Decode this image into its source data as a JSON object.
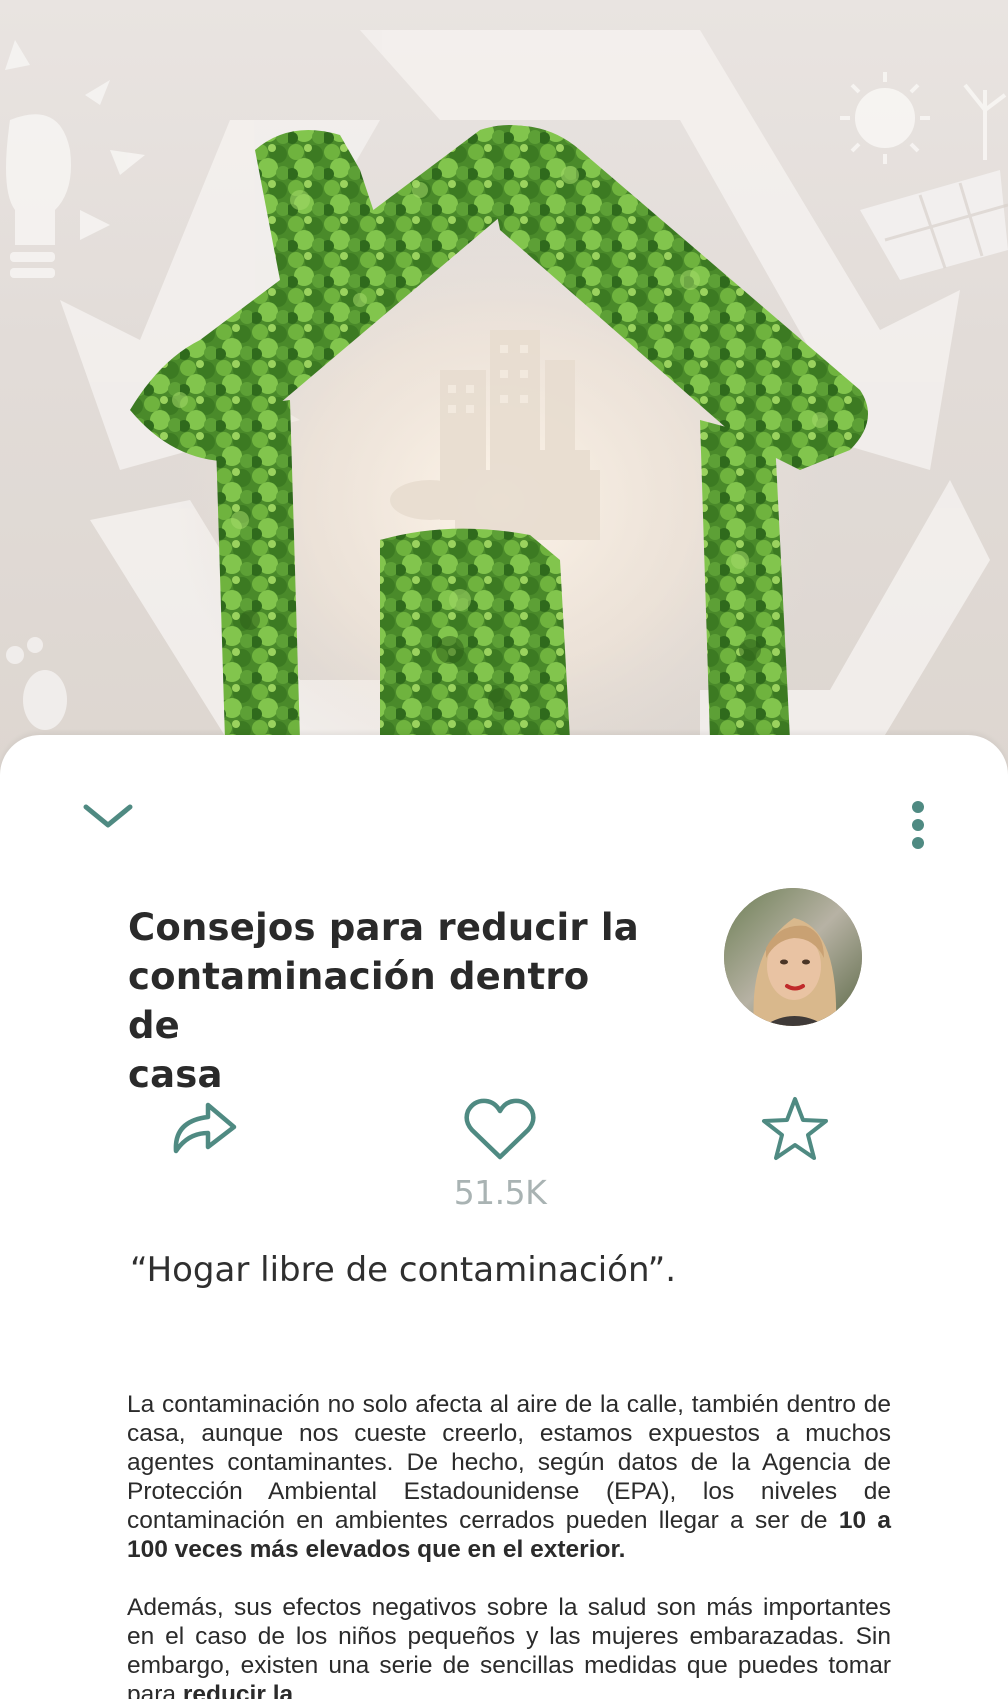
{
  "hero": {
    "image": "eco-house-of-leaves-illustration"
  },
  "toolbar": {
    "collapse_icon": "chevron-down-icon",
    "more_icon": "more-vertical-icon"
  },
  "article": {
    "title_line1": "Consejos para reducir la",
    "title_line2": "contaminación dentro de",
    "title_line3": "casa",
    "author_avatar": "author-avatar-photo",
    "quote": "“Hogar libre de contaminación”.",
    "paragraphs": [
      {
        "text": "La contaminación no solo afecta al aire de la calle, también dentro de casa, aunque nos cueste creerlo, estamos expuestos a muchos agentes contaminantes. De hecho, según datos de la Agencia de Protección Ambiental Estadounidense (EPA), los niveles de contaminación en ambientes cerrados pueden llegar a ser de ",
        "bold": "10 a 100 veces más elevados que en el exterior."
      },
      {
        "text": "Además, sus efectos negativos sobre la salud son más importantes en el caso de los niños pequeños y las mujeres embarazadas. Sin embargo, existen una serie de sencillas medidas que puedes tomar para ",
        "bold": "reducir la"
      }
    ]
  },
  "actions": {
    "share_icon": "share-icon",
    "like_icon": "heart-icon",
    "like_count": "51.5K",
    "favorite_icon": "star-icon"
  },
  "colors": {
    "accent": "#4f8a82",
    "title": "#2a2a2a",
    "like_count": "#a9b3b3",
    "leaf_dark": "#3f7d24",
    "leaf_light": "#7ec04a"
  }
}
